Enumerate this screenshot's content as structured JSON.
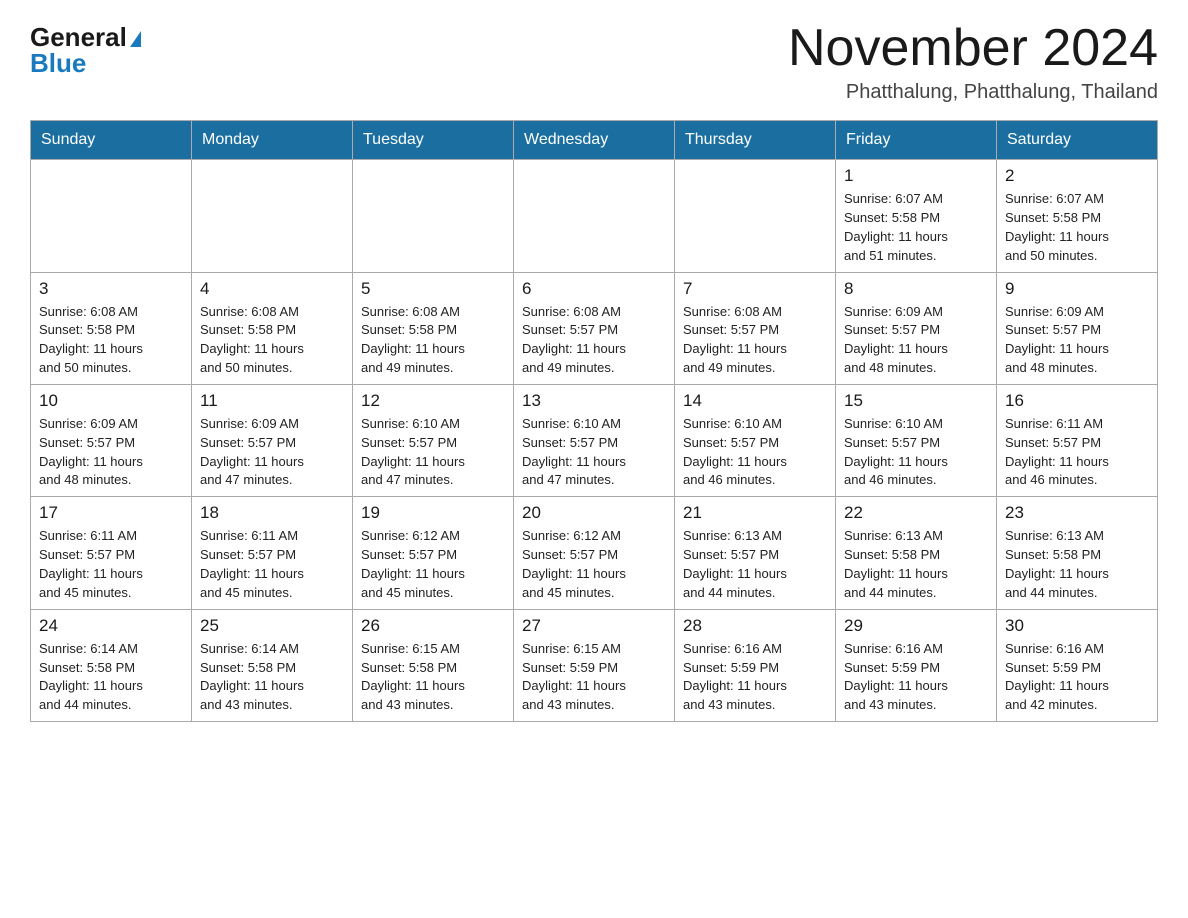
{
  "header": {
    "logo_general": "General",
    "logo_blue": "Blue",
    "month_title": "November 2024",
    "location": "Phatthalung, Phatthalung, Thailand"
  },
  "weekdays": [
    "Sunday",
    "Monday",
    "Tuesday",
    "Wednesday",
    "Thursday",
    "Friday",
    "Saturday"
  ],
  "weeks": [
    [
      {
        "day": "",
        "info": ""
      },
      {
        "day": "",
        "info": ""
      },
      {
        "day": "",
        "info": ""
      },
      {
        "day": "",
        "info": ""
      },
      {
        "day": "",
        "info": ""
      },
      {
        "day": "1",
        "info": "Sunrise: 6:07 AM\nSunset: 5:58 PM\nDaylight: 11 hours\nand 51 minutes."
      },
      {
        "day": "2",
        "info": "Sunrise: 6:07 AM\nSunset: 5:58 PM\nDaylight: 11 hours\nand 50 minutes."
      }
    ],
    [
      {
        "day": "3",
        "info": "Sunrise: 6:08 AM\nSunset: 5:58 PM\nDaylight: 11 hours\nand 50 minutes."
      },
      {
        "day": "4",
        "info": "Sunrise: 6:08 AM\nSunset: 5:58 PM\nDaylight: 11 hours\nand 50 minutes."
      },
      {
        "day": "5",
        "info": "Sunrise: 6:08 AM\nSunset: 5:58 PM\nDaylight: 11 hours\nand 49 minutes."
      },
      {
        "day": "6",
        "info": "Sunrise: 6:08 AM\nSunset: 5:57 PM\nDaylight: 11 hours\nand 49 minutes."
      },
      {
        "day": "7",
        "info": "Sunrise: 6:08 AM\nSunset: 5:57 PM\nDaylight: 11 hours\nand 49 minutes."
      },
      {
        "day": "8",
        "info": "Sunrise: 6:09 AM\nSunset: 5:57 PM\nDaylight: 11 hours\nand 48 minutes."
      },
      {
        "day": "9",
        "info": "Sunrise: 6:09 AM\nSunset: 5:57 PM\nDaylight: 11 hours\nand 48 minutes."
      }
    ],
    [
      {
        "day": "10",
        "info": "Sunrise: 6:09 AM\nSunset: 5:57 PM\nDaylight: 11 hours\nand 48 minutes."
      },
      {
        "day": "11",
        "info": "Sunrise: 6:09 AM\nSunset: 5:57 PM\nDaylight: 11 hours\nand 47 minutes."
      },
      {
        "day": "12",
        "info": "Sunrise: 6:10 AM\nSunset: 5:57 PM\nDaylight: 11 hours\nand 47 minutes."
      },
      {
        "day": "13",
        "info": "Sunrise: 6:10 AM\nSunset: 5:57 PM\nDaylight: 11 hours\nand 47 minutes."
      },
      {
        "day": "14",
        "info": "Sunrise: 6:10 AM\nSunset: 5:57 PM\nDaylight: 11 hours\nand 46 minutes."
      },
      {
        "day": "15",
        "info": "Sunrise: 6:10 AM\nSunset: 5:57 PM\nDaylight: 11 hours\nand 46 minutes."
      },
      {
        "day": "16",
        "info": "Sunrise: 6:11 AM\nSunset: 5:57 PM\nDaylight: 11 hours\nand 46 minutes."
      }
    ],
    [
      {
        "day": "17",
        "info": "Sunrise: 6:11 AM\nSunset: 5:57 PM\nDaylight: 11 hours\nand 45 minutes."
      },
      {
        "day": "18",
        "info": "Sunrise: 6:11 AM\nSunset: 5:57 PM\nDaylight: 11 hours\nand 45 minutes."
      },
      {
        "day": "19",
        "info": "Sunrise: 6:12 AM\nSunset: 5:57 PM\nDaylight: 11 hours\nand 45 minutes."
      },
      {
        "day": "20",
        "info": "Sunrise: 6:12 AM\nSunset: 5:57 PM\nDaylight: 11 hours\nand 45 minutes."
      },
      {
        "day": "21",
        "info": "Sunrise: 6:13 AM\nSunset: 5:57 PM\nDaylight: 11 hours\nand 44 minutes."
      },
      {
        "day": "22",
        "info": "Sunrise: 6:13 AM\nSunset: 5:58 PM\nDaylight: 11 hours\nand 44 minutes."
      },
      {
        "day": "23",
        "info": "Sunrise: 6:13 AM\nSunset: 5:58 PM\nDaylight: 11 hours\nand 44 minutes."
      }
    ],
    [
      {
        "day": "24",
        "info": "Sunrise: 6:14 AM\nSunset: 5:58 PM\nDaylight: 11 hours\nand 44 minutes."
      },
      {
        "day": "25",
        "info": "Sunrise: 6:14 AM\nSunset: 5:58 PM\nDaylight: 11 hours\nand 43 minutes."
      },
      {
        "day": "26",
        "info": "Sunrise: 6:15 AM\nSunset: 5:58 PM\nDaylight: 11 hours\nand 43 minutes."
      },
      {
        "day": "27",
        "info": "Sunrise: 6:15 AM\nSunset: 5:59 PM\nDaylight: 11 hours\nand 43 minutes."
      },
      {
        "day": "28",
        "info": "Sunrise: 6:16 AM\nSunset: 5:59 PM\nDaylight: 11 hours\nand 43 minutes."
      },
      {
        "day": "29",
        "info": "Sunrise: 6:16 AM\nSunset: 5:59 PM\nDaylight: 11 hours\nand 43 minutes."
      },
      {
        "day": "30",
        "info": "Sunrise: 6:16 AM\nSunset: 5:59 PM\nDaylight: 11 hours\nand 42 minutes."
      }
    ]
  ]
}
